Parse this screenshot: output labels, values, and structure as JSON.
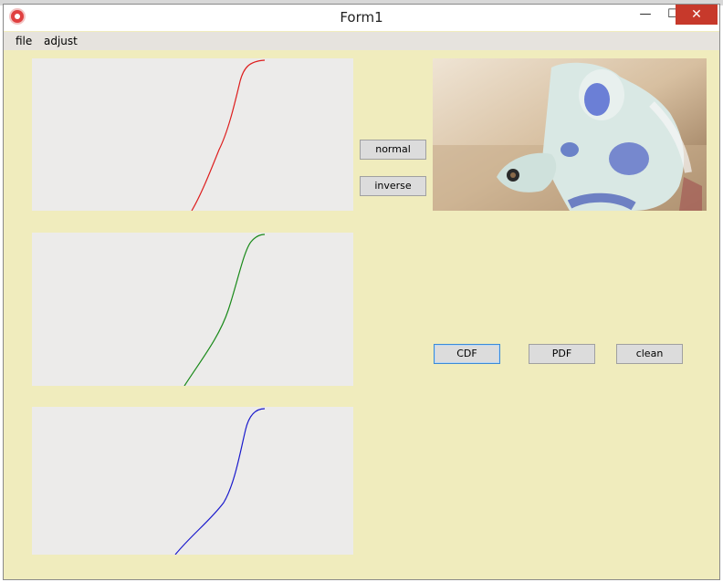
{
  "window": {
    "title": "Form1"
  },
  "controls": {
    "minimize": "—",
    "maximize": "☐",
    "close": "✕"
  },
  "menu": {
    "items": [
      "file",
      "adjust"
    ]
  },
  "buttons": {
    "normal": "normal",
    "inverse": "inverse",
    "cdf": "CDF",
    "pdf": "PDF",
    "clean": "clean"
  },
  "colors": {
    "form_bg": "#f0ecbd",
    "panel_bg": "#ecebea",
    "red_curve": "#dd1e1e",
    "green_curve": "#1a8a1a",
    "blue_curve": "#1a1acc"
  },
  "curves": [
    {
      "color_key": "red_curve",
      "icon": "red-cdf-curve"
    },
    {
      "color_key": "green_curve",
      "icon": "green-cdf-curve"
    },
    {
      "color_key": "blue_curve",
      "icon": "blue-cdf-curve"
    }
  ]
}
